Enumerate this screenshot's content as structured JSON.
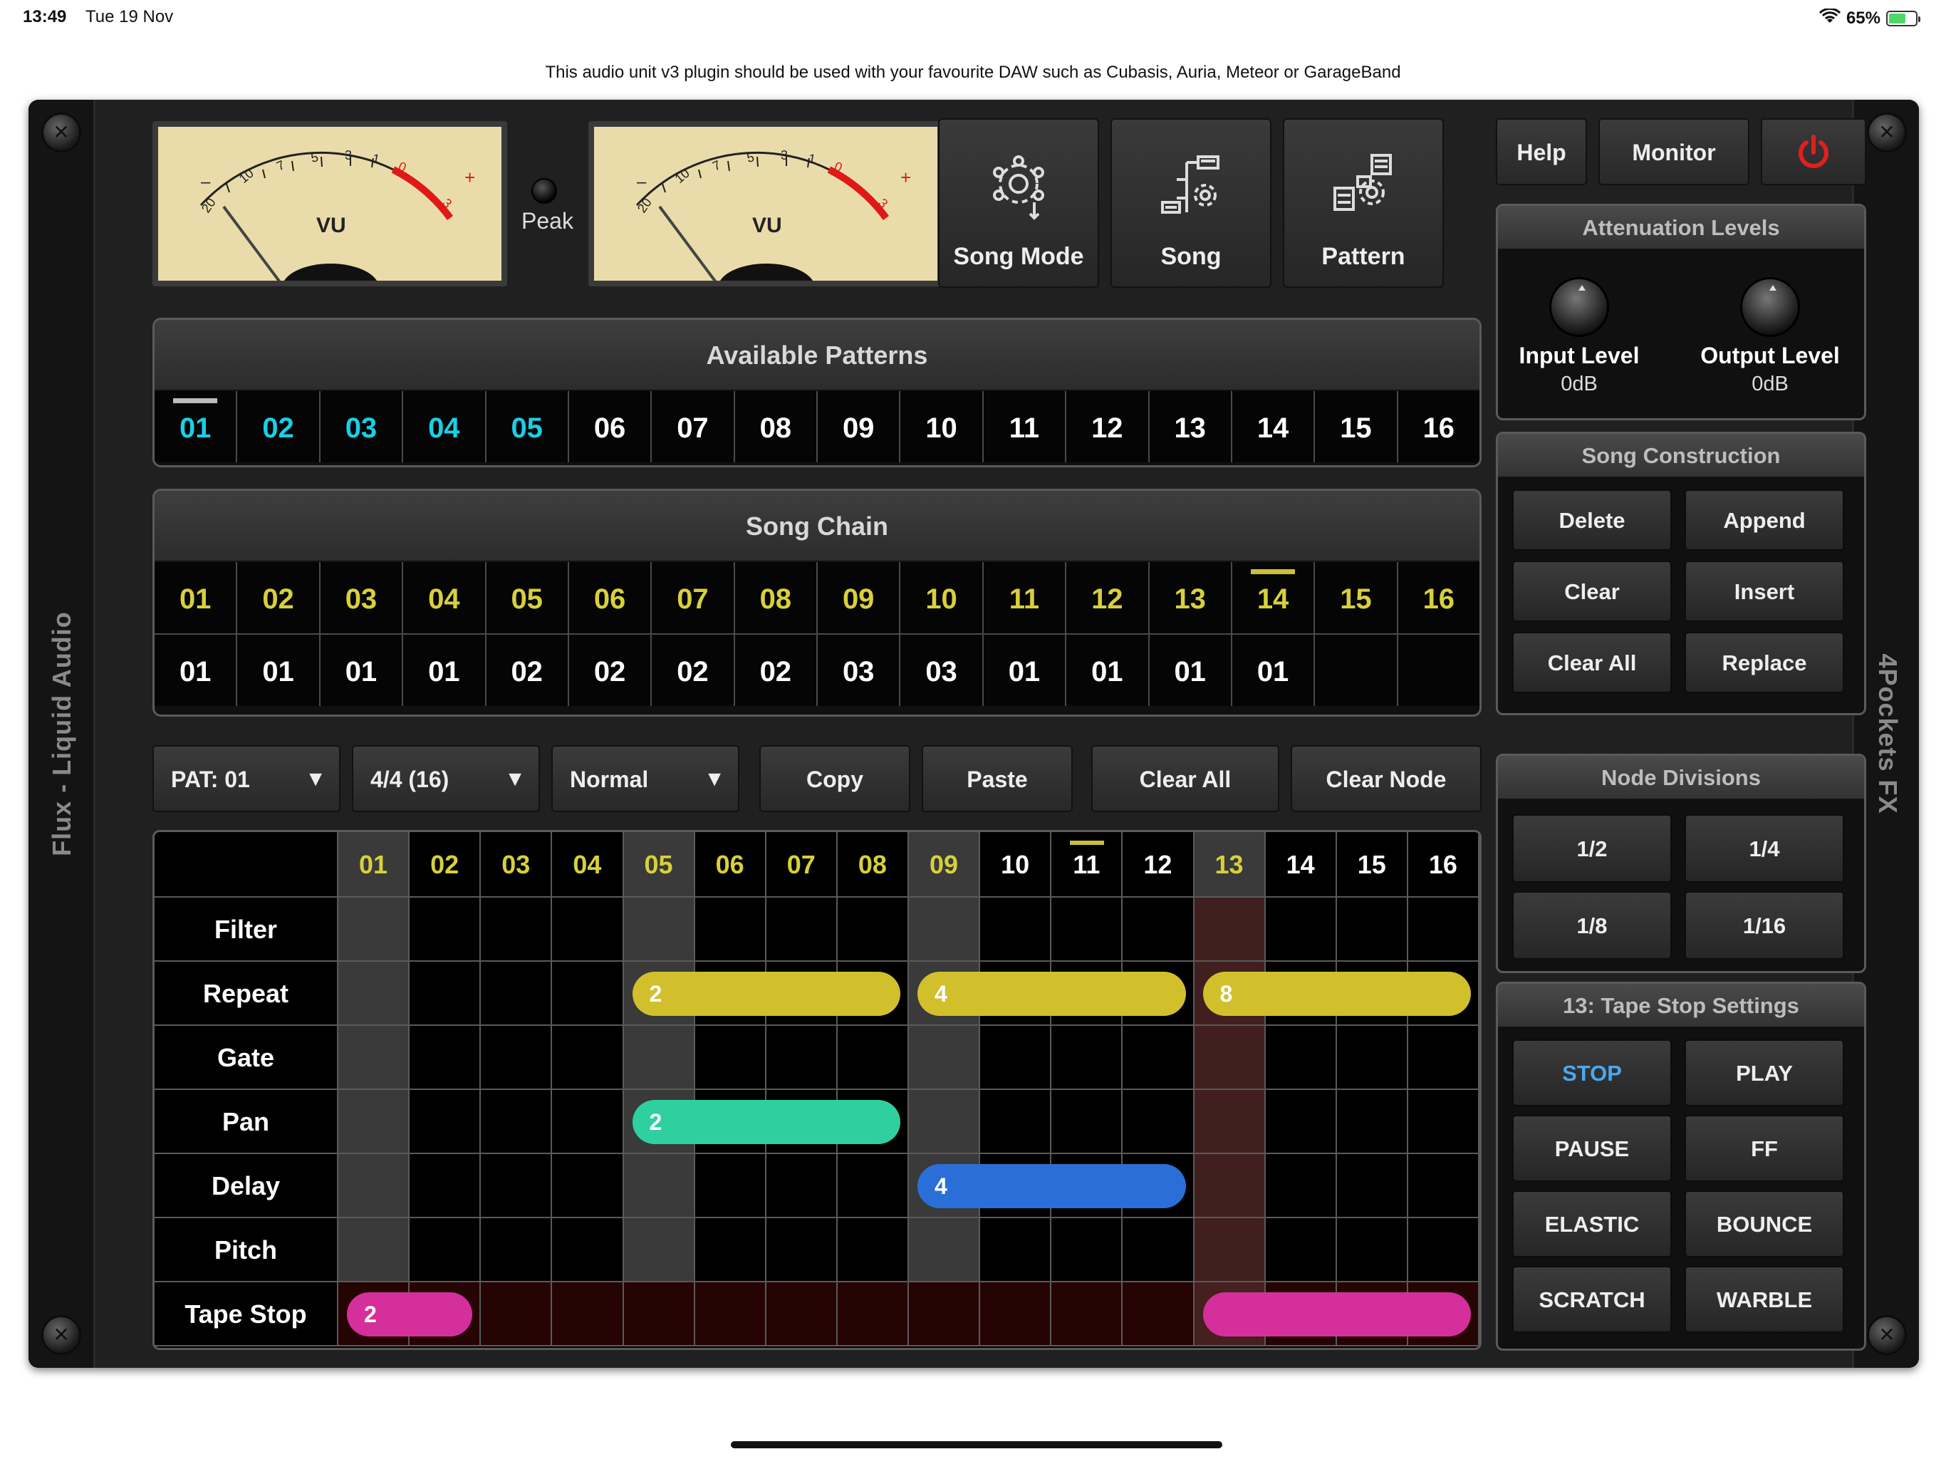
{
  "status_bar": {
    "time": "13:49",
    "date": "Tue 19 Nov",
    "battery": "65%"
  },
  "banner": "This audio unit v3 plugin should be used with your favourite DAW such as Cubasis, Auria, Meteor or GarageBand",
  "rails": {
    "left_label": "Flux - Liquid Audio",
    "right_label": "4Pockets FX"
  },
  "vu": {
    "label": "VU",
    "peak_label": "Peak",
    "scale": [
      "20",
      "10",
      "7",
      "5",
      "3",
      "1",
      "0",
      "3"
    ],
    "minus": "–",
    "plus": "+"
  },
  "modes": {
    "song_mode": "Song Mode",
    "song": "Song",
    "pattern": "Pattern"
  },
  "top_buttons": {
    "help": "Help",
    "monitor": "Monitor"
  },
  "available_patterns": {
    "title": "Available Patterns",
    "items": [
      "01",
      "02",
      "03",
      "04",
      "05",
      "06",
      "07",
      "08",
      "09",
      "10",
      "11",
      "12",
      "13",
      "14",
      "15",
      "16"
    ],
    "active_count": 5
  },
  "song_chain": {
    "title": "Song Chain",
    "positions": [
      "01",
      "02",
      "03",
      "04",
      "05",
      "06",
      "07",
      "08",
      "09",
      "10",
      "11",
      "12",
      "13",
      "14",
      "15",
      "16"
    ],
    "patterns": [
      "01",
      "01",
      "01",
      "01",
      "02",
      "02",
      "02",
      "02",
      "03",
      "03",
      "01",
      "01",
      "01",
      "01",
      "",
      ""
    ],
    "marker_position": "14"
  },
  "toolbar": {
    "pattern": "PAT: 01",
    "time_sig": "4/4 (16)",
    "mode": "Normal",
    "copy": "Copy",
    "paste": "Paste",
    "clear_all": "Clear All",
    "clear_node": "Clear Node",
    "dropdown_arrow": "▼"
  },
  "grid": {
    "columns": [
      "01",
      "02",
      "03",
      "04",
      "05",
      "06",
      "07",
      "08",
      "09",
      "10",
      "11",
      "12",
      "13",
      "14",
      "15",
      "16"
    ],
    "rows": [
      "Filter",
      "Repeat",
      "Gate",
      "Pan",
      "Delay",
      "Pitch",
      "Tape Stop"
    ],
    "playhead_column": "11",
    "selected_column": "13",
    "events": [
      {
        "row": "Repeat",
        "start": 5,
        "length": 4,
        "value": "2",
        "color": "yellow"
      },
      {
        "row": "Repeat",
        "start": 9,
        "length": 4,
        "value": "4",
        "color": "yellow"
      },
      {
        "row": "Repeat",
        "start": 13,
        "length": 4,
        "value": "8",
        "color": "yellow"
      },
      {
        "row": "Pan",
        "start": 5,
        "length": 4,
        "value": "2",
        "color": "green"
      },
      {
        "row": "Delay",
        "start": 9,
        "length": 4,
        "value": "4",
        "color": "blue"
      },
      {
        "row": "Tape Stop",
        "start": 1,
        "length": 2,
        "value": "2",
        "color": "magenta"
      },
      {
        "row": "Tape Stop",
        "start": 13,
        "length": 4,
        "value": "",
        "color": "magenta"
      }
    ]
  },
  "attenuation": {
    "title": "Attenuation Levels",
    "input_label": "Input Level",
    "input_value": "0dB",
    "output_label": "Output Level",
    "output_value": "0dB"
  },
  "song_construction": {
    "title": "Song Construction",
    "buttons": [
      "Delete",
      "Append",
      "Clear",
      "Insert",
      "Clear All",
      "Replace"
    ]
  },
  "node_divisions": {
    "title": "Node Divisions",
    "buttons": [
      "1/2",
      "1/4",
      "1/8",
      "1/16"
    ]
  },
  "tape_stop_settings": {
    "title": "13: Tape Stop Settings",
    "buttons": [
      "STOP",
      "PLAY",
      "PAUSE",
      "FF",
      "ELASTIC",
      "BOUNCE",
      "SCRATCH",
      "WARBLE"
    ],
    "active": "STOP"
  },
  "colors": {
    "cyan": "#18d0e8",
    "yellow_text": "#d8d03a",
    "bar_yellow": "#d1c02c",
    "bar_green": "#2fd09f",
    "bar_blue": "#2a6fd8",
    "bar_magenta": "#d52f9c",
    "power_red": "#e02020",
    "active_blue": "#4aa8f0"
  }
}
